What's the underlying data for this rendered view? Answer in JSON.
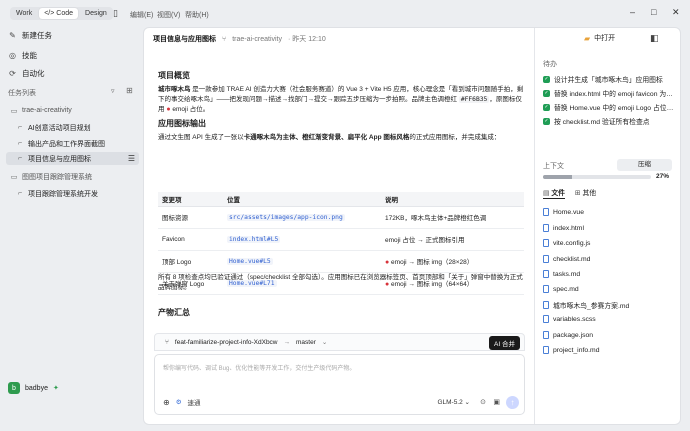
{
  "topbar": {
    "modes": [
      "Work",
      "</> Code",
      "Design"
    ],
    "menu": [
      "编辑(E)",
      "视图(V)",
      "帮助(H)"
    ]
  },
  "sidebar": {
    "nav": [
      {
        "icon": "edit-icon",
        "label": "新建任务"
      },
      {
        "icon": "skill-icon",
        "label": "技能"
      },
      {
        "icon": "automation-icon",
        "label": "自动化"
      }
    ],
    "task_list_title": "任务列表",
    "groups": [
      {
        "name": "trae-ai-creativity",
        "tasks": [
          "AI创意活动项目规划",
          "输出产品和工作界面截图",
          "项目信息与应用图标"
        ]
      },
      {
        "name": "图图项目跟踪管理系统",
        "tasks": [
          "项目跟踪管理系统开发"
        ]
      }
    ],
    "user": {
      "name": "badbye",
      "avatar_letter": "b"
    }
  },
  "header": {
    "title": "项目信息与应用图标",
    "branch": "trae-ai-creativity",
    "time": "· 昨天 12:10",
    "open_in": "中打开"
  },
  "content": {
    "h_overview": "项目概览",
    "overview_lead": "城市啄木鸟",
    "overview_text": " 是一款参加 TRAE AI 创造力大赛（社会服务赛道）的 Vue 3 + Vite H5 应用，核心理念是「看到城市问题随手拍，剩下的事交给啄木鸟」——把发现问题→描述→找部门→提交→跟踪五步压缩为一步拍照。品牌主色调橙红",
    "brand_color": "#FF6B35",
    "overview_tail": "，原图标仅用",
    "overview_end": "emoji 占位。",
    "h_icon": "应用图标输出",
    "icon_text_1": "通过文生图 API 生成了一张以",
    "icon_bold": "卡通啄木鸟为主体、橙红渐变背景、扁平化 App 图标风格",
    "icon_text_2": "的正式应用图标，并完成集成：",
    "table": {
      "headers": [
        "变更项",
        "位置",
        "说明"
      ],
      "rows": [
        [
          "图标资源",
          "src/assets/images/app-icon.png",
          "172KB，啄木鸟主体+品牌橙红色调"
        ],
        [
          "Favicon",
          "index.html#L5",
          "emoji 占位 → 正式图标引用"
        ],
        [
          "顶部 Logo",
          "Home.vue#L5",
          "emoji → 图标 img（28×28）"
        ],
        [
          "关于弹窗 Logo",
          "Home.vue#L71",
          "emoji → 图标 img（64×64）"
        ]
      ]
    },
    "summary": "所有 8 项检查点均已验证通过（spec/checklist 全部勾选）。应用图标已在浏览器标签页、首页顶部和「关于」弹窗中替换为正式品牌图标。",
    "h_artifacts": "产物汇总"
  },
  "branchbar": {
    "branch": "feat-familiarize-project-info-XdXbcw",
    "arrow": "→",
    "target": "master",
    "merge_label": "AI 合并"
  },
  "input": {
    "placeholder": "帮你编写代码、调试 Bug、优化性能等开发工作，交付生产级代码产物。",
    "speed_label": "速通",
    "model": "GLM-5.2"
  },
  "right": {
    "todo_title": "待办",
    "todos": [
      "设计并生成「城市啄木鸟」应用图标",
      "替换 index.html 中的 emoji favicon 为…",
      "替换 Home.vue 中的 emoji Logo 占位…",
      "按 checklist.md 验证所有检查点"
    ],
    "context_title": "上下文",
    "compress_label": "压缩",
    "context_percent": 27,
    "context_percent_label": "27%",
    "tabs": [
      "文件",
      "其他"
    ],
    "files": [
      "Home.vue",
      "index.html",
      "vite.config.js",
      "checklist.md",
      "tasks.md",
      "spec.md",
      "城市啄木鸟_参赛方案.md",
      "variables.scss",
      "package.json",
      "project_info.md"
    ]
  }
}
